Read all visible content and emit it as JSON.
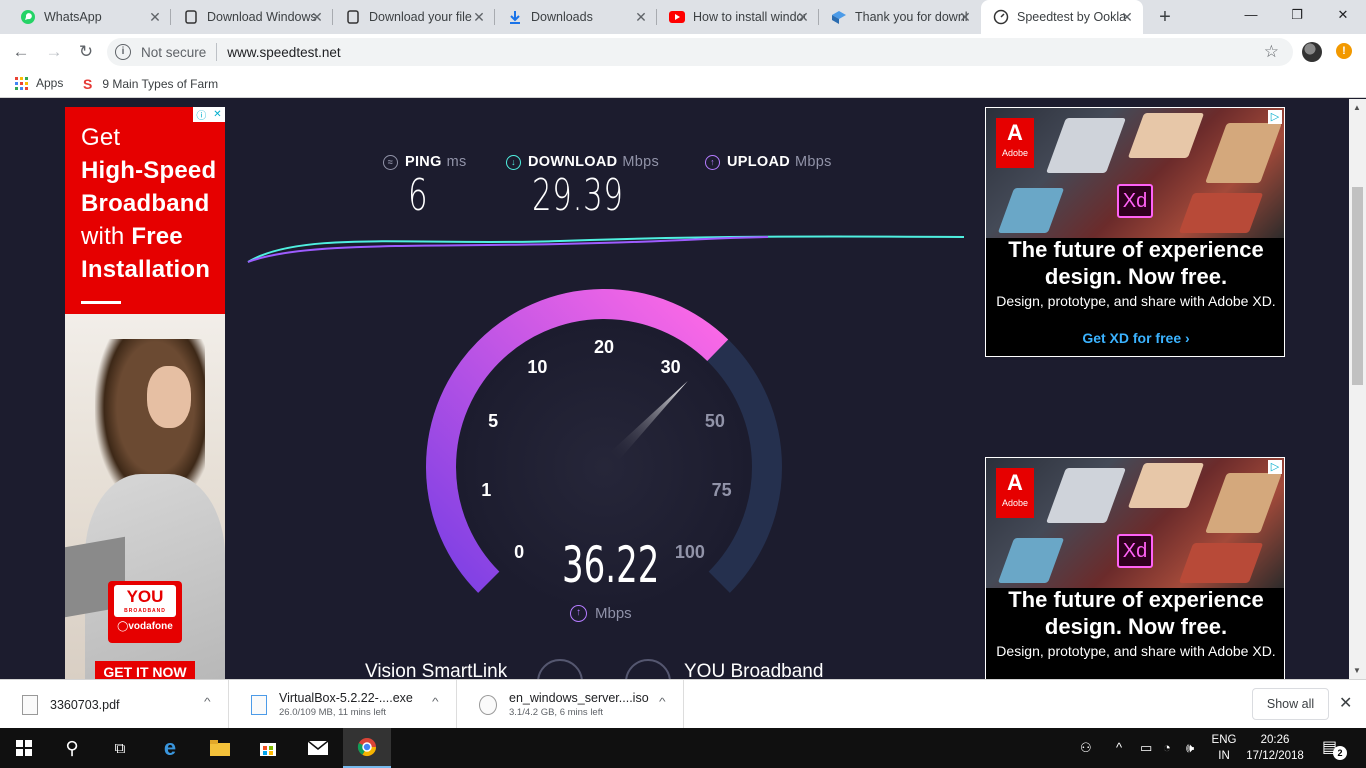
{
  "browser": {
    "tabs": [
      {
        "label": "WhatsApp",
        "icon": "whatsapp-icon"
      },
      {
        "label": "Download Windows",
        "icon": "page-icon"
      },
      {
        "label": "Download your file",
        "icon": "page-icon"
      },
      {
        "label": "Downloads",
        "icon": "download-icon"
      },
      {
        "label": "How to install windows",
        "icon": "youtube-icon"
      },
      {
        "label": "Thank you for downloading",
        "icon": "virtualbox-icon"
      },
      {
        "label": "Speedtest by Ookla",
        "icon": "speedtest-icon"
      }
    ],
    "active_tab": 6,
    "security": "Not secure",
    "url": "www.speedtest.net",
    "bookmarks": [
      {
        "label": "Apps"
      },
      {
        "label": "9 Main Types of Farm"
      }
    ],
    "alert_badge": "!"
  },
  "ads": {
    "left": {
      "line1": "Get",
      "line2": "High-Speed",
      "line3": "Broadband",
      "line4_a": "with",
      "line4_b": "Free",
      "line5": "Installation",
      "brand": "YOU",
      "brand_sub": "BROADBAND",
      "brand_partner": "vodafone",
      "cta": "GET IT NOW"
    },
    "right_top": {
      "logo": "Adobe",
      "product": "Xd",
      "headline": "The future of experience design. Now free.",
      "body": "Design, prototype, and share with Adobe XD.",
      "cta": "Get XD for free ›"
    },
    "right_bottom": {
      "logo": "Adobe",
      "product": "Xd",
      "headline": "The future of experience design. Now free.",
      "body": "Design, prototype, and share with Adobe XD."
    }
  },
  "speedtest": {
    "ping": {
      "label": "PING",
      "unit": "ms",
      "value": "6"
    },
    "download": {
      "label": "DOWNLOAD",
      "unit": "Mbps",
      "value": "29.39"
    },
    "upload": {
      "label": "UPLOAD",
      "unit": "Mbps",
      "value": ""
    },
    "gauge": {
      "ticks": [
        "0",
        "1",
        "5",
        "10",
        "20",
        "30",
        "50",
        "75",
        "100"
      ],
      "current": "36.22",
      "current_numeric": 36.22,
      "unit": "Mbps"
    },
    "isp": "Vision SmartLink",
    "server": "YOU Broadband",
    "colors": {
      "accent_gradient_start": "#7b3fe4",
      "accent_gradient_end": "#ff6ae6",
      "track": "#25304e",
      "download_line": "#4ff0e0",
      "upload_line": "#9d5cff"
    }
  },
  "downloads": [
    {
      "name": "3360703.pdf",
      "status": ""
    },
    {
      "name": "VirtualBox-5.2.22-....exe",
      "status": "26.0/109 MB, 11 mins left"
    },
    {
      "name": "en_windows_server....iso",
      "status": "3.1/4.2 GB, 6 mins left"
    }
  ],
  "downloads_show_all": "Show all",
  "taskbar": {
    "lang_top": "ENG",
    "lang_bottom": "IN",
    "time": "20:26",
    "date": "17/12/2018",
    "notifications": "2"
  }
}
